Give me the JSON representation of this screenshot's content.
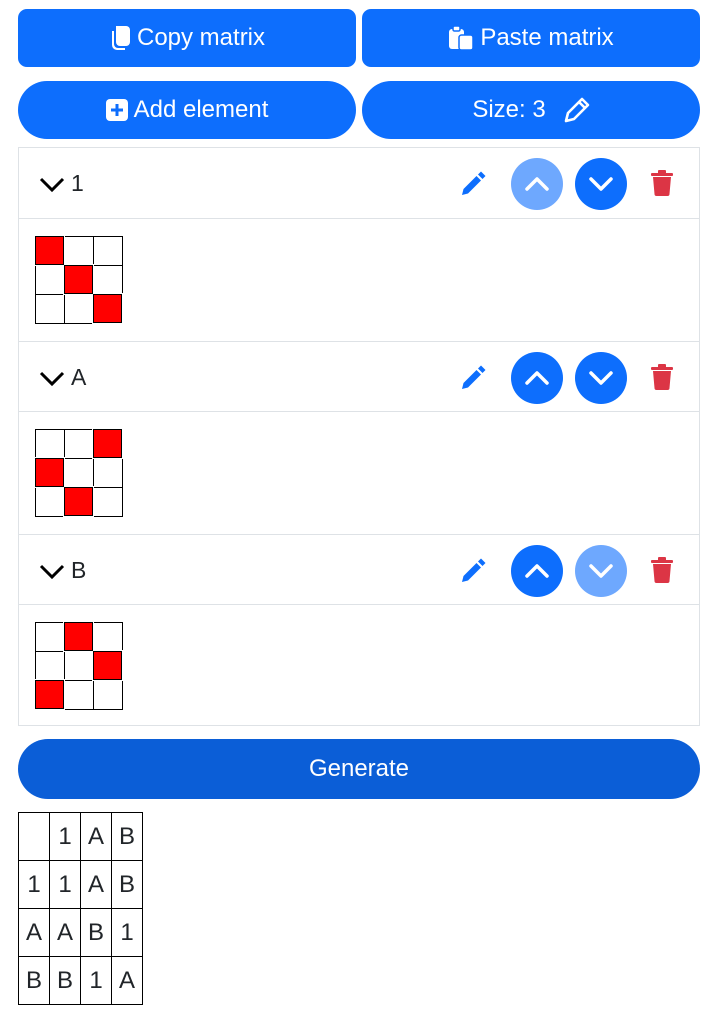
{
  "toolbar": {
    "copy_label": "Copy matrix",
    "paste_label": "Paste matrix",
    "add_label": "Add element",
    "size_label": "Size: 3"
  },
  "colors": {
    "primary": "#0d6efd",
    "primary_disabled": "#6ea8fe",
    "danger": "#dc3545",
    "cell_on": "#ff0000"
  },
  "elements": [
    {
      "label": "1",
      "up_disabled": true,
      "down_disabled": false,
      "matrix": [
        [
          1,
          0,
          0
        ],
        [
          0,
          1,
          0
        ],
        [
          0,
          0,
          1
        ]
      ]
    },
    {
      "label": "A",
      "up_disabled": false,
      "down_disabled": false,
      "matrix": [
        [
          0,
          0,
          1
        ],
        [
          1,
          0,
          0
        ],
        [
          0,
          1,
          0
        ]
      ]
    },
    {
      "label": "B",
      "up_disabled": false,
      "down_disabled": true,
      "matrix": [
        [
          0,
          1,
          0
        ],
        [
          0,
          0,
          1
        ],
        [
          1,
          0,
          0
        ]
      ]
    }
  ],
  "generate_label": "Generate",
  "result_table": [
    [
      "",
      "1",
      "A",
      "B"
    ],
    [
      "1",
      "1",
      "A",
      "B"
    ],
    [
      "A",
      "A",
      "B",
      "1"
    ],
    [
      "B",
      "B",
      "1",
      "A"
    ]
  ]
}
